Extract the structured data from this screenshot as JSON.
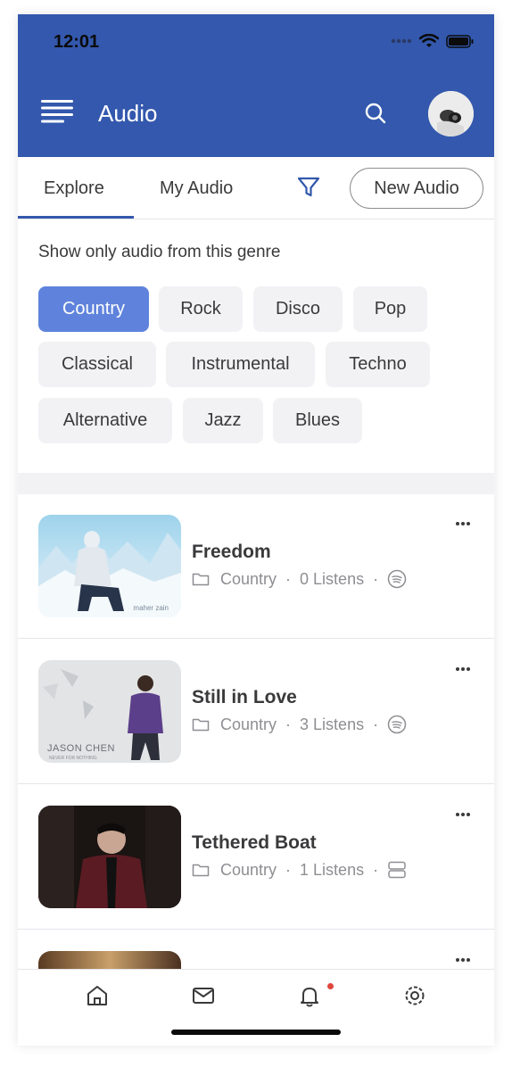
{
  "status_bar": {
    "time": "12:01"
  },
  "app_bar": {
    "title": "Audio"
  },
  "tabs": [
    {
      "label": "Explore",
      "active": true
    },
    {
      "label": "My Audio",
      "active": false
    }
  ],
  "new_audio_label": "New Audio",
  "genre_filter": {
    "label": "Show only audio from this genre",
    "selected": "Country",
    "genres": [
      "Country",
      "Rock",
      "Disco",
      "Pop",
      "Classical",
      "Instrumental",
      "Techno",
      "Alternative",
      "Jazz",
      "Blues"
    ]
  },
  "audio_items": [
    {
      "title": "Freedom",
      "genre": "Country",
      "listens": "0 Listens",
      "source_icon": "spotify-icon",
      "thumb_caption": "maher zain"
    },
    {
      "title": "Still in Love",
      "genre": "Country",
      "listens": "3 Listens",
      "source_icon": "spotify-icon",
      "thumb_caption": "JASON CHEN",
      "thumb_subcaption": "NEVER FOR NOTHING"
    },
    {
      "title": "Tethered Boat",
      "genre": "Country",
      "listens": "1 Listens",
      "source_icon": "server-icon"
    },
    {
      "title": "",
      "genre": "",
      "listens": ""
    }
  ],
  "separator": "·",
  "bottom_nav": [
    "home-icon",
    "mail-icon",
    "bell-icon",
    "settings-icon"
  ],
  "colors": {
    "header": "#3358ad",
    "active_chip": "#5f83dc",
    "chip": "#f2f2f5",
    "notification_dot": "#e0453a"
  }
}
